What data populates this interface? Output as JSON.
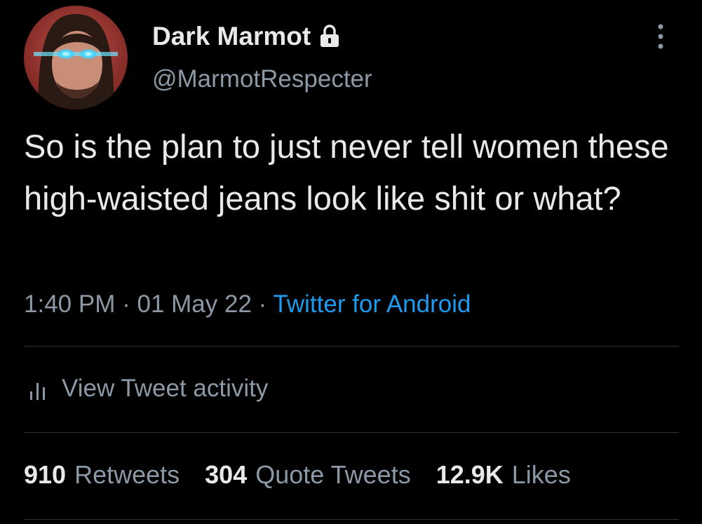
{
  "author": {
    "name": "Dark Marmot",
    "handle": "@MarmotRespecter",
    "protected": true
  },
  "tweet": {
    "text": "So is the plan to just never tell women these high-waisted jeans look like shit or what?",
    "time": "1:40 PM",
    "date": "01 May 22",
    "separator": "·",
    "source": "Twitter for Android"
  },
  "activity": {
    "label": "View Tweet activity"
  },
  "stats": {
    "retweets_count": "910",
    "retweets_label": "Retweets",
    "quotes_count": "304",
    "quotes_label": "Quote Tweets",
    "likes_count": "12.9K",
    "likes_label": "Likes"
  },
  "colors": {
    "background": "#000000",
    "text_primary": "#e7e9ea",
    "text_secondary": "#8b98a5",
    "link": "#1d9bf0",
    "divider": "#2f3336"
  },
  "icons": {
    "lock": "lock-icon",
    "more": "more-vertical-icon",
    "activity": "bar-chart-icon"
  }
}
